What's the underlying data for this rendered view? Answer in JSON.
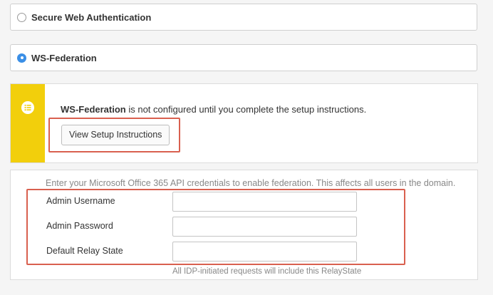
{
  "options": {
    "secure_web_auth": {
      "label": "Secure Web Authentication",
      "selected": false
    },
    "ws_federation": {
      "label": "WS-Federation",
      "selected": true
    }
  },
  "notice": {
    "icon": "list-icon",
    "stripe_color": "#f2cf0c",
    "bold_text": "WS-Federation",
    "text": " is not configured until you complete the setup instructions.",
    "button_label": "View Setup Instructions"
  },
  "credentials": {
    "intro": "Enter your Microsoft Office 365 API credentials to enable federation. This affects all users in the domain.",
    "fields": [
      {
        "label": "Admin Username",
        "value": "",
        "placeholder": ""
      },
      {
        "label": "Admin Password",
        "value": "",
        "placeholder": ""
      },
      {
        "label": "Default Relay State",
        "value": "",
        "placeholder": ""
      }
    ],
    "relay_help": "All IDP-initiated requests will include this RelayState"
  },
  "colors": {
    "accent": "#3b8fe6",
    "highlight": "#d9604f"
  }
}
